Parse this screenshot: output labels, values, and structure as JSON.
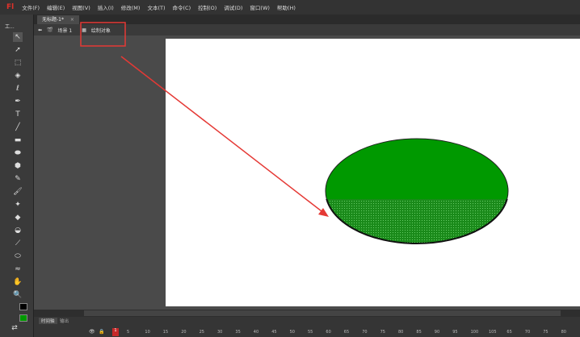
{
  "app": {
    "logo": "Fl"
  },
  "menu": [
    "文件(F)",
    "编辑(E)",
    "视图(V)",
    "插入(I)",
    "修改(M)",
    "文本(T)",
    "命令(C)",
    "控制(O)",
    "调试(D)",
    "窗口(W)",
    "帮助(H)"
  ],
  "document_tab": "无标题-1*",
  "tab_close": "×",
  "breadcrumb": {
    "scene": "场景 1",
    "object": "绘制对象"
  },
  "toolbar_label": "工...",
  "colors": {
    "stroke": "#000000",
    "fill": "#009900",
    "accent": "#e0322a"
  },
  "timeline": {
    "tabs": [
      "时间轴",
      "输出"
    ],
    "current_frame": "1",
    "ticks": [
      "5",
      "10",
      "15",
      "20",
      "25",
      "30",
      "35",
      "40",
      "45",
      "50",
      "55",
      "60",
      "65",
      "70",
      "75",
      "80",
      "85",
      "90",
      "95",
      "100",
      "105",
      "65",
      "70",
      "75",
      "80"
    ]
  }
}
